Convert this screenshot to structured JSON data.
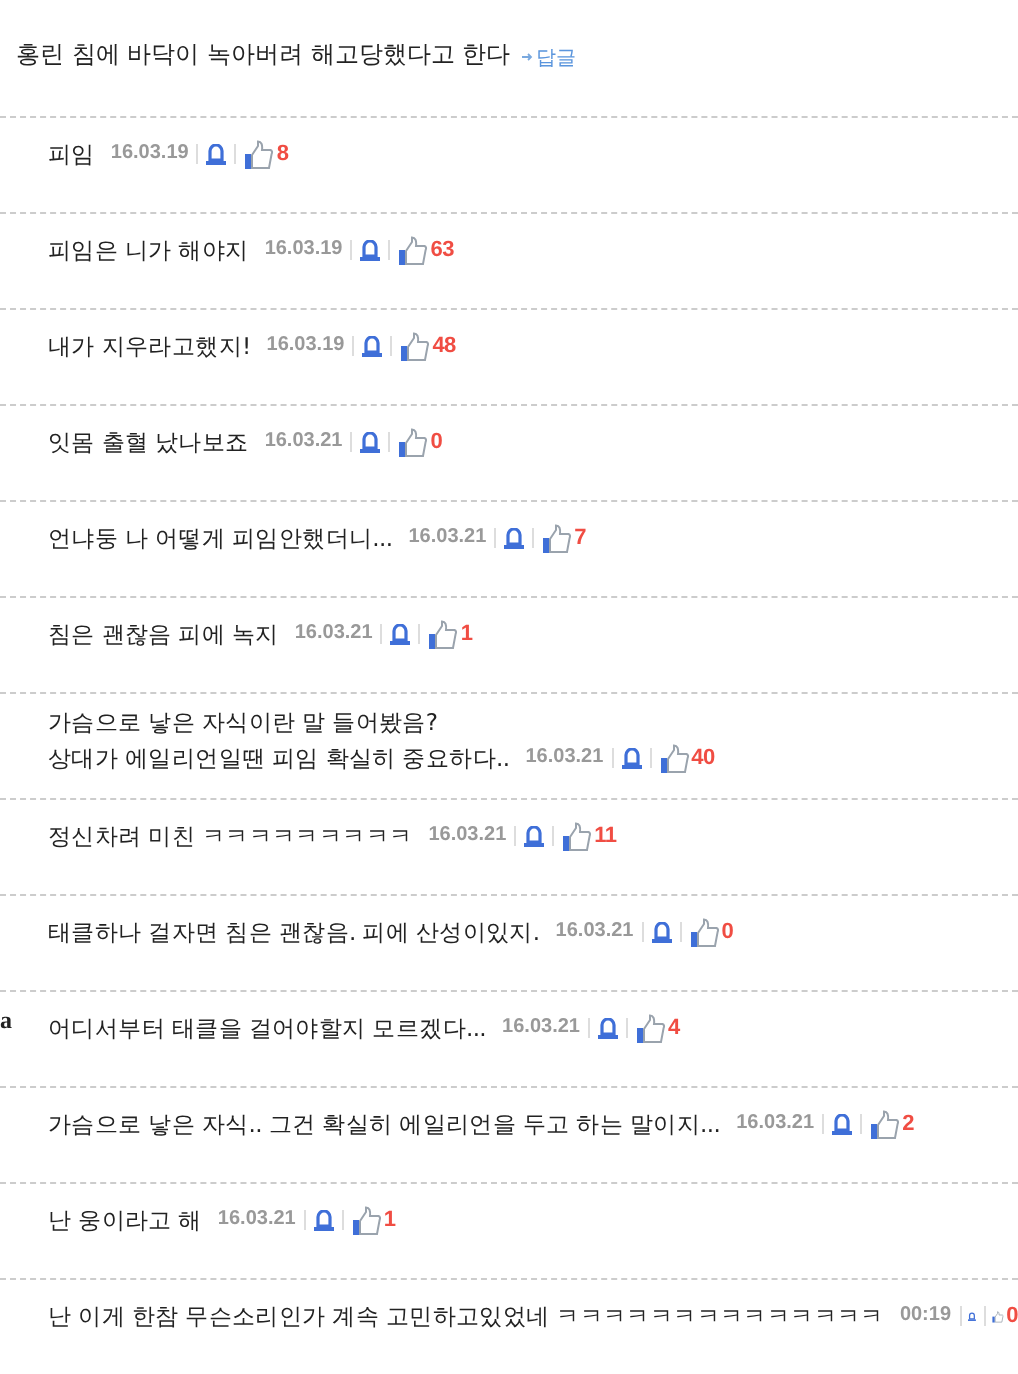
{
  "post": {
    "text": "홍린 침에 바닥이 녹아버려 해고당했다고 한다",
    "reply_link": "답글"
  },
  "comments": [
    {
      "lines": [
        "피임"
      ],
      "date": "16.03.19",
      "likes": "8"
    },
    {
      "lines": [
        "피임은 니가 해야지"
      ],
      "date": "16.03.19",
      "likes": "63"
    },
    {
      "lines": [
        "내가 지우라고했지!"
      ],
      "date": "16.03.19",
      "likes": "48"
    },
    {
      "lines": [
        "잇몸 출혈 났나보죠"
      ],
      "date": "16.03.21",
      "likes": "0"
    },
    {
      "lines": [
        "언냐둥 나 어떻게 피임안했더니..."
      ],
      "date": "16.03.21",
      "likes": "7"
    },
    {
      "lines": [
        "침은 괜찮음 피에 녹지"
      ],
      "date": "16.03.21",
      "likes": "1"
    },
    {
      "lines": [
        "가슴으로 낳은 자식이란 말 들어봤음?",
        "상대가 에일리언일땐 피임 확실히 중요하다.."
      ],
      "date": "16.03.21",
      "likes": "40"
    },
    {
      "lines": [
        "정신차려 미친 ㅋㅋㅋㅋㅋㅋㅋㅋㅋ"
      ],
      "date": "16.03.21",
      "likes": "11"
    },
    {
      "lines": [
        "태클하나 걸자면 침은 괜찮음. 피에 산성이있지."
      ],
      "date": "16.03.21",
      "likes": "0"
    },
    {
      "lines": [
        "어디서부터 태클을 걸어야할지 모르겠다..."
      ],
      "date": "16.03.21",
      "likes": "4",
      "side_text": "a"
    },
    {
      "lines": [
        "가슴으로 낳은 자식.. 그건 확실히 에일리언을 두고 하는 말이지..."
      ],
      "date": "16.03.21",
      "likes": "2"
    },
    {
      "lines": [
        "난 웅이라고 해"
      ],
      "date": "16.03.21",
      "likes": "1"
    },
    {
      "lines": [
        "난 이게 한참 무슨소리인가 계속 고민하고있었네 ㅋㅋㅋㅋㅋㅋㅋㅋㅋㅋㅋㅋㅋㅋ"
      ],
      "date": "00:19",
      "likes": "0"
    }
  ]
}
